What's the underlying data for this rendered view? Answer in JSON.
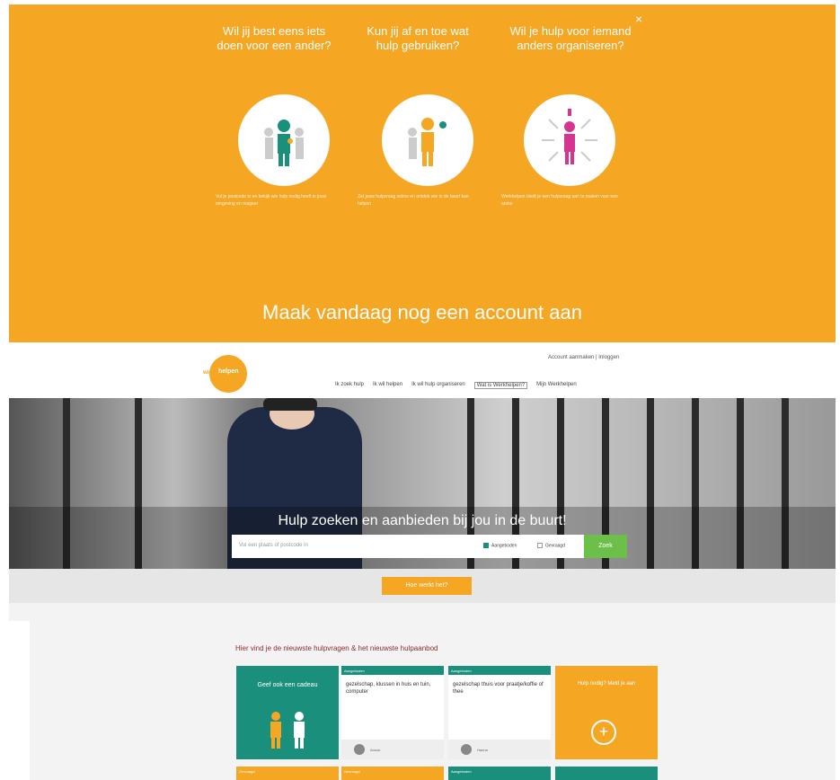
{
  "promo": {
    "close_label": "×",
    "columns": [
      {
        "title": "Wil jij best eens iets doen voor een ander?",
        "desc": "Vul je postcode in en bekijk wie hulp nodig heeft in jouw omgeving en reageer"
      },
      {
        "title": "Kun jij af en toe wat hulp gebruiken?",
        "desc": "Zet jouw hulpvraag online en ontdek wie in de buurt kan helpen"
      },
      {
        "title": "Wil je hulp voor iemand anders organiseren?",
        "desc": "Werkhelpen biedt je een hulpvraag aan te maken voor een ander"
      }
    ],
    "cta": "Maak vandaag nog een account aan"
  },
  "header": {
    "logo_prefix": "wie",
    "logo_text": "helpen",
    "auth": "Account aanmaken | Inloggen",
    "nav": [
      "Ik zoek hulp",
      "Ik wil helpen",
      "Ik wil hulp organiseren",
      "Wat is Werkhelpen?",
      "Mijn Werkhelpen"
    ]
  },
  "hero": {
    "title": "Hulp zoeken en aanbieden bij jou in de buurt!",
    "search_placeholder": "Vul een plaats of postcode in",
    "opt_offered": "Aangeboden",
    "opt_requested": "Gevraagd",
    "search_btn": "Zoek"
  },
  "how_btn": "Hoe werkt het?",
  "list": {
    "heading": "Hier vind je de nieuwste hulpvragen & het nieuwste hulpaanbod",
    "cards": [
      {
        "type": "gift",
        "title": "Geef ook een cadeau"
      },
      {
        "tag": "Aangeboden",
        "title": "gezelschap, klussen in huis en tuin, computer",
        "name": "Anouk"
      },
      {
        "tag": "Aangeboden",
        "title": "gezelschap thuis voor praatje/koffie of thee",
        "name": "Hanna"
      },
      {
        "type": "cta",
        "title": "Hulp nodig? Meld je aan",
        "plus": "+"
      }
    ],
    "bottom_tags": [
      "Gevraagd",
      "Gevraagd",
      "Aangeboden",
      ""
    ]
  },
  "colors": {
    "orange": "#f5a623",
    "teal": "#1a8f7c",
    "green": "#6cc04a"
  }
}
